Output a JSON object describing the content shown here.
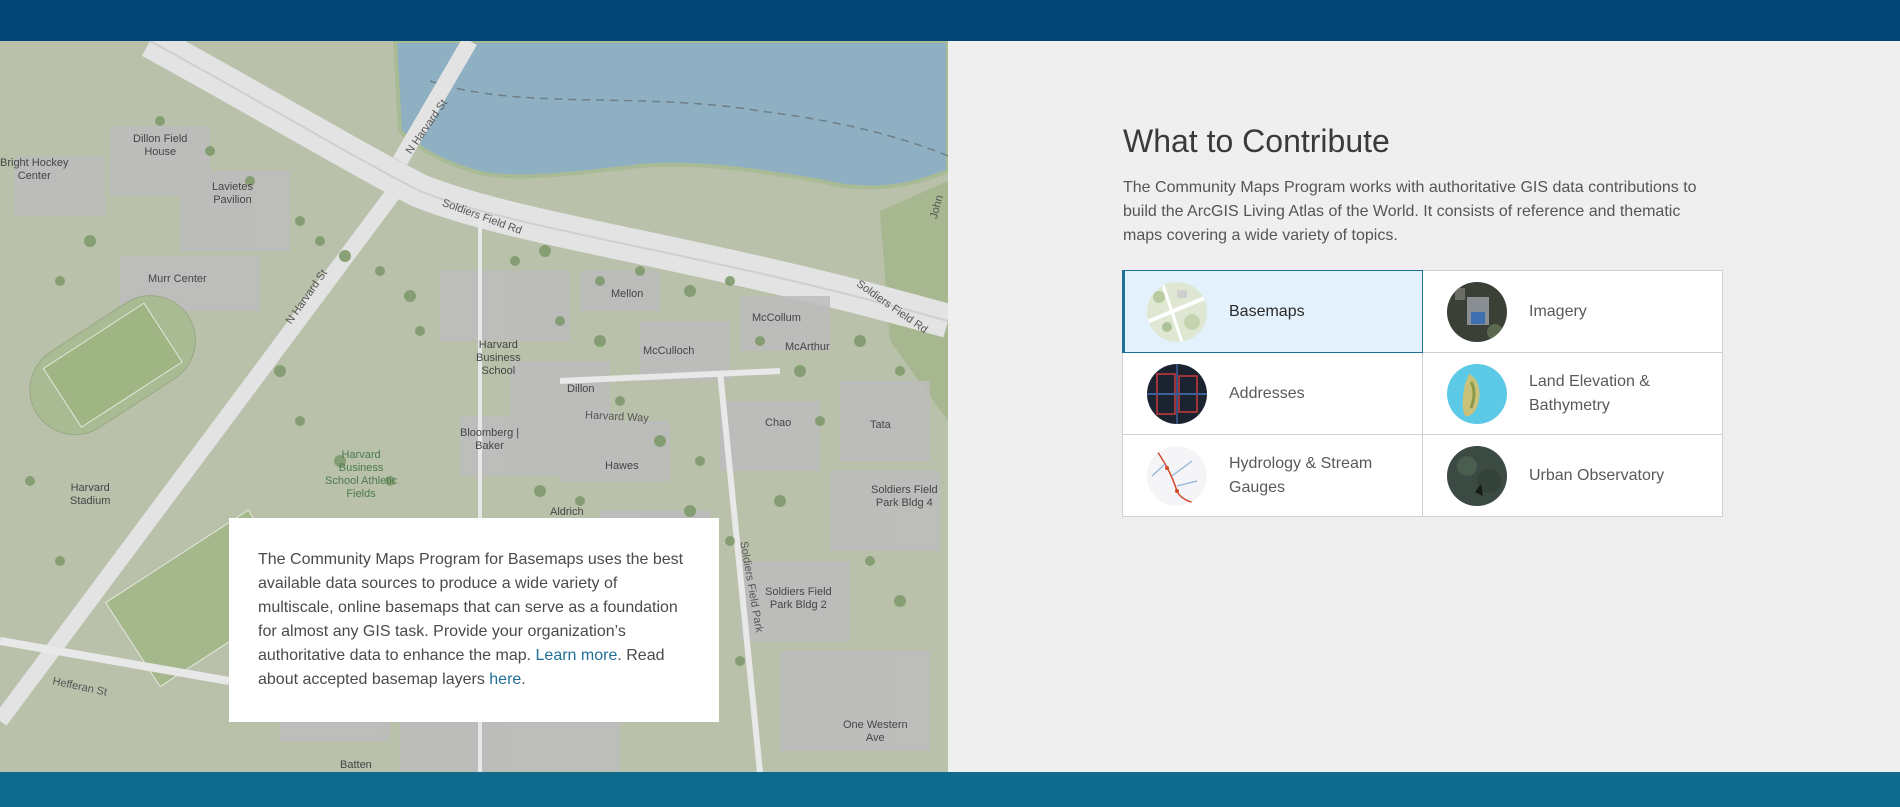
{
  "map": {
    "labels": [
      {
        "text": "Dillon Field\nHouse"
      },
      {
        "text": "Bright Hockey\nCenter"
      },
      {
        "text": "Lavietes\nPavilion"
      },
      {
        "text": "Murr Center"
      },
      {
        "text": "Harvard\nBusiness\nSchool"
      },
      {
        "text": "Mellon"
      },
      {
        "text": "McCollum"
      },
      {
        "text": "McCulloch"
      },
      {
        "text": "McArthur"
      },
      {
        "text": "Dillon"
      },
      {
        "text": "Chao"
      },
      {
        "text": "Tata"
      },
      {
        "text": "Bloomberg |\nBaker"
      },
      {
        "text": "Hawes"
      },
      {
        "text": "Harvard\nStadium"
      },
      {
        "text": "Aldrich"
      },
      {
        "text": "Soldiers Field\nPark Bldg 4"
      },
      {
        "text": "Soldiers Field\nPark Bldg 2"
      },
      {
        "text": "One Western\nAve"
      },
      {
        "text": "Batten"
      }
    ],
    "green_labels": [
      {
        "text": "Harvard\nBusiness\nSchool Athletic\nFields"
      }
    ],
    "road_labels": [
      {
        "text": "N Harvard St"
      },
      {
        "text": "Soldiers Field Rd"
      },
      {
        "text": "N Harvard St"
      },
      {
        "text": "Soldiers Field Rd"
      },
      {
        "text": "Harvard Way"
      },
      {
        "text": "Hefferan St"
      },
      {
        "text": "Soldiers Field Park"
      },
      {
        "text": "John"
      }
    ]
  },
  "info_card": {
    "text_before": "The Community Maps Program for Basemaps uses the best available data sources to produce a wide variety of multiscale, online basemaps that can serve as a foundation for almost any GIS task. Provide your organization’s authoritative data to enhance the map. ",
    "learn_more": "Learn more",
    "text_middle": ". Read about accepted basemap layers ",
    "here": "here",
    "text_after": "."
  },
  "section": {
    "title": "What to Contribute",
    "description": "The Community Maps Program works with authoritative GIS data contributions to build the ArcGIS Living Atlas of the World. It consists of reference and thematic maps covering a wide variety of topics."
  },
  "tiles": [
    {
      "label": "Basemaps",
      "icon": "basemap-thumbnail",
      "active": true
    },
    {
      "label": "Imagery",
      "icon": "imagery-thumbnail",
      "active": false
    },
    {
      "label": "Addresses",
      "icon": "addresses-thumbnail",
      "active": false
    },
    {
      "label": "Land Elevation & Bathymetry",
      "icon": "elevation-thumbnail",
      "active": false
    },
    {
      "label": "Hydrology & Stream Gauges",
      "icon": "hydrology-thumbnail",
      "active": false
    },
    {
      "label": "Urban Observatory",
      "icon": "urban-thumbnail",
      "active": false
    }
  ],
  "colors": {
    "header": "#004575",
    "footer": "#0f6b8e",
    "accent": "#1f6f99",
    "active_tile_bg": "#e2f1fb"
  }
}
